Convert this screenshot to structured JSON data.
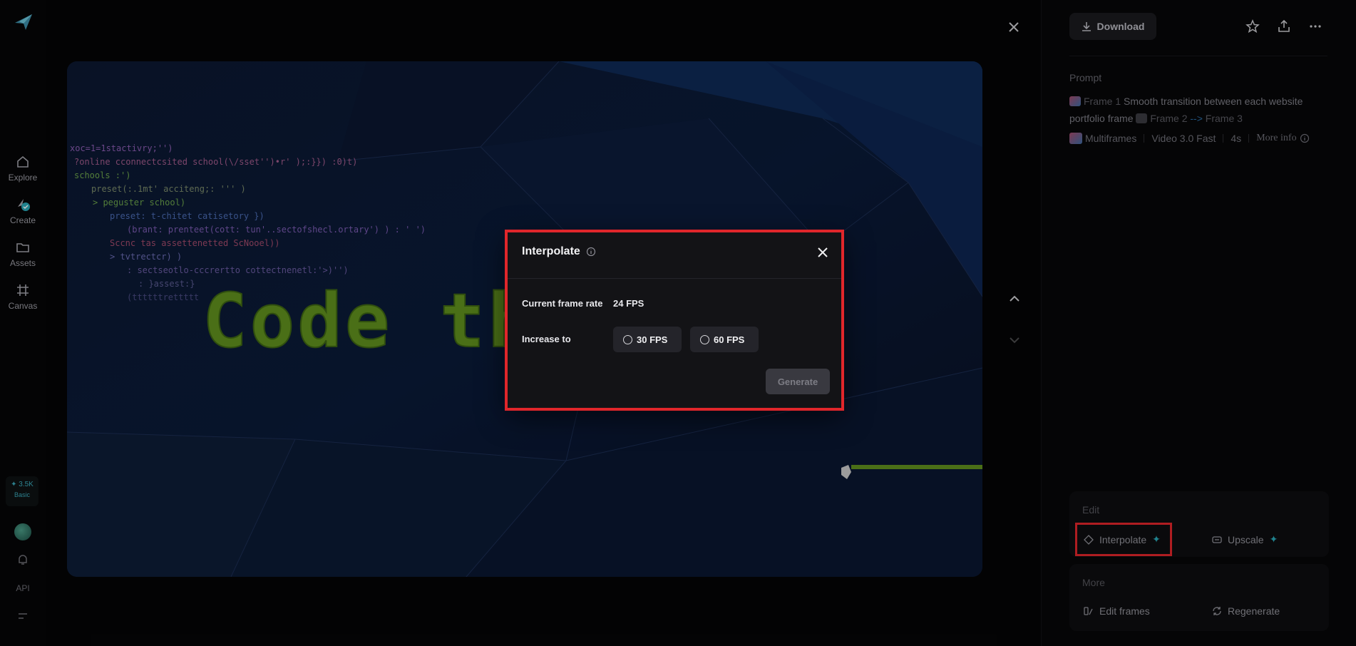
{
  "rail": {
    "items": [
      {
        "label": "Explore",
        "icon": "home-icon"
      },
      {
        "label": "Create",
        "icon": "create-icon"
      },
      {
        "label": "Assets",
        "icon": "folder-icon"
      },
      {
        "label": "Canvas",
        "icon": "canvas-icon"
      }
    ],
    "credits_value": "✦ 3.5K",
    "credits_plan": "Basic",
    "api_label": "API"
  },
  "preview": {
    "headline": "Code th",
    "code_lines": [
      "xoc=1=1stactivry;'')",
      "?online cconnectcsited school(\\/sset'')•r' );:}}) :0)t)",
      "schools :')",
      "preset(:.1mt' acciteng;: ''' )",
      ">  peguster school)",
      "preset: t-chitet catisetory })",
      "(brant: prenteet(cott: tun'..sectofshecl.ortary') ) : ' ')",
      "Sccnc tas assettenetted ScNooel))",
      "> tvtrectcr) )",
      ":   sectseotlo-cccrertto cottectnenetl:'>)'')",
      ":   }assest:}",
      "(ttttttrettttt"
    ]
  },
  "panel": {
    "download_label": "Download",
    "prompt_heading": "Prompt",
    "prompt": {
      "frame1": "Frame 1",
      "text": "Smooth transition between each website portfolio frame",
      "frame2": "Frame 2",
      "arrow": "-->",
      "frame3": "Frame 3"
    },
    "meta": {
      "mode": "Multiframes",
      "model": "Video 3.0 Fast",
      "duration": "4s",
      "more_info": "More info"
    },
    "edit_heading": "Edit",
    "interpolate_label": "Interpolate",
    "upscale_label": "Upscale",
    "more_heading": "More",
    "edit_frames_label": "Edit frames",
    "regenerate_label": "Regenerate"
  },
  "modal": {
    "title": "Interpolate",
    "current_rate_label": "Current frame rate",
    "current_rate_value": "24 FPS",
    "increase_label": "Increase to",
    "options": [
      "30 FPS",
      "60 FPS"
    ],
    "generate_label": "Generate"
  },
  "colors": {
    "highlight": "#e0262b",
    "accent": "#2aa7b6",
    "code_green": "#5f8f1e"
  }
}
